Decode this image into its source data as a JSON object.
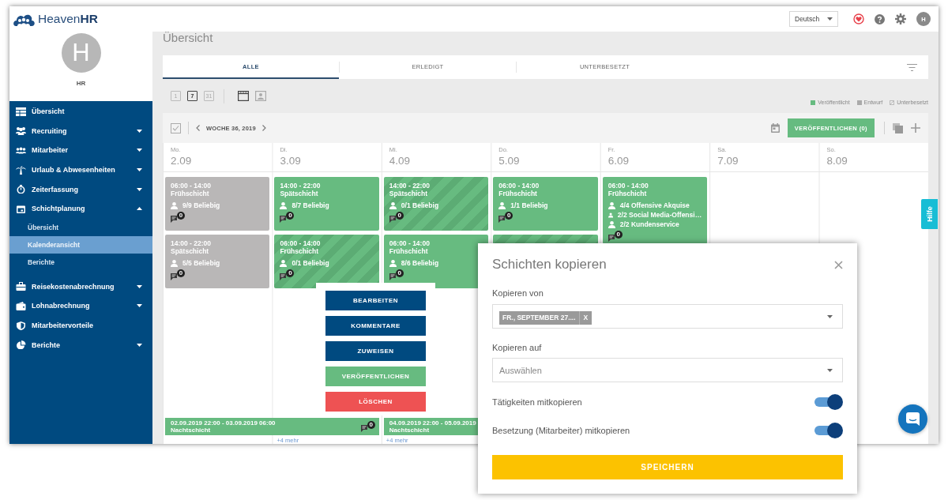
{
  "topbar": {
    "logo": "Heaven**HR**",
    "language": "Deutsch",
    "avatar": "H"
  },
  "profile": {
    "initial": "H",
    "name": "HR"
  },
  "sidebar": [
    {
      "label": "Übersicht",
      "selected": false
    },
    {
      "label": "Recruiting",
      "selected": false,
      "expanded": false
    },
    {
      "label": "Mitarbeiter",
      "selected": false,
      "expanded": false
    },
    {
      "label": "Urlaub & Abwesenheiten",
      "selected": false,
      "expanded": false
    },
    {
      "label": "Zeiterfassung",
      "selected": false,
      "expanded": false
    },
    {
      "label": "Schichtplanung",
      "selected": false,
      "expanded": true,
      "children": [
        {
          "label": "Übersicht",
          "selected": false
        },
        {
          "label": "Kalenderansicht",
          "selected": true
        },
        {
          "label": "Berichte",
          "selected": false
        }
      ]
    },
    {
      "label": "Reisekostenabrechnung",
      "selected": false,
      "expanded": false
    },
    {
      "label": "Lohnabrechnung",
      "selected": false,
      "expanded": false
    },
    {
      "label": "Mitarbeitervorteile",
      "selected": false
    },
    {
      "label": "Berichte",
      "selected": false,
      "expanded": false
    }
  ],
  "page_title": "Übersicht",
  "tabs": [
    {
      "label": "ALLE",
      "selected": true
    },
    {
      "label": "ERLEDIGT",
      "selected": false
    },
    {
      "label": "UNTERBESETZT",
      "selected": false
    }
  ],
  "range_buttons": [
    {
      "label": "1",
      "selected": false
    },
    {
      "label": "7",
      "selected": true
    },
    {
      "label": "31",
      "selected": false
    }
  ],
  "layout_buttons": [
    {
      "selected": true
    },
    {
      "selected": false
    }
  ],
  "legend": [
    {
      "label": "Veröffentlicht",
      "kind": "published"
    },
    {
      "label": "Entwurf",
      "kind": "draft"
    },
    {
      "label": "Unterbesetzt",
      "kind": "understaffed"
    }
  ],
  "week": "WOCHE 36, 2019",
  "publish_button": "VERÖFFENTLICHEN (0)",
  "days": [
    {
      "weekday": "Mo.",
      "date": "2.09",
      "shifts": [
        {
          "time": "06:00 - 14:00",
          "name": "Frühschicht",
          "kind": "draft",
          "understaffed": false,
          "assignments": [
            "9/9 Beliebig"
          ],
          "comments": "0"
        },
        {
          "time": "14:00 - 22:00",
          "name": "Spätschicht",
          "kind": "draft",
          "understaffed": false,
          "assignments": [
            "5/5 Beliebig"
          ],
          "comments": "0"
        }
      ],
      "night_shift": {
        "time": "02.09.2019 22:00 - 03.09.2019 06:00",
        "name": "Nachtschicht",
        "comments": "0"
      }
    },
    {
      "weekday": "Di.",
      "date": "3.09",
      "shifts": [
        {
          "time": "14:00 - 22:00",
          "name": "Spätschicht",
          "kind": "published",
          "understaffed": false,
          "assignments": [
            "8/7 Beliebig"
          ],
          "comments": "0"
        },
        {
          "time": "06:00 - 14:00",
          "name": "Frühschicht",
          "kind": "published",
          "understaffed": true,
          "assignments": [
            "0/1 Beliebig"
          ],
          "comments": "0"
        }
      ],
      "more": "+4 mehr"
    },
    {
      "weekday": "Mi.",
      "date": "4.09",
      "shifts": [
        {
          "time": "14:00 - 22:00",
          "name": "Spätschicht",
          "kind": "published",
          "understaffed": true,
          "assignments": [
            "0/1 Beliebig"
          ],
          "comments": "0"
        },
        {
          "time": "06:00 - 14:00",
          "name": "Frühschicht",
          "kind": "published",
          "understaffed": false,
          "assignments": [
            "8/6 Beliebig"
          ],
          "comments": "0"
        }
      ],
      "night_shift": {
        "time": "04.09.2019 22:00 - 05.09.2019",
        "name": "Nachtschicht"
      },
      "more": "+4 mehr"
    },
    {
      "weekday": "Do.",
      "date": "5.09",
      "shifts": [
        {
          "time": "06:00 - 14:00",
          "name": "Frühschicht",
          "kind": "published",
          "understaffed": false,
          "assignments": [
            "1/1 Beliebig"
          ],
          "comments": "0"
        },
        {
          "kind": "published",
          "understaffed": true
        }
      ]
    },
    {
      "weekday": "Fr.",
      "date": "6.09",
      "shifts": [
        {
          "time": "06:00 - 14:00",
          "name": "Frühschicht",
          "kind": "published",
          "understaffed": false,
          "assignments": [
            "4/4 Offensive Akquise",
            "2/2 Social Media-Offensi…",
            "2/2 Kundenservice"
          ],
          "comments": "0"
        }
      ]
    },
    {
      "weekday": "Sa.",
      "date": "7.09"
    },
    {
      "weekday": "So.",
      "date": "8.09"
    }
  ],
  "context_menu": [
    {
      "label": "BEARBEITEN",
      "kind": "primary"
    },
    {
      "label": "KOMMENTARE",
      "kind": "primary"
    },
    {
      "label": "ZUWEISEN",
      "kind": "primary"
    },
    {
      "label": "VERÖFFENTLICHEN",
      "kind": "publish"
    },
    {
      "label": "LÖSCHEN",
      "kind": "danger"
    }
  ],
  "dialog": {
    "title": "Schichten kopieren",
    "from": {
      "label": "Kopieren von",
      "chip": "FR., SEPTEMBER 27....",
      "chip_remove": "X"
    },
    "to": {
      "label": "Kopieren auf",
      "placeholder": "Auswählen"
    },
    "toggles": [
      {
        "label": "Tätigkeiten mitkopieren",
        "on": true
      },
      {
        "label": "Besetzung (Mitarbeiter) mitkopieren",
        "on": true
      }
    ],
    "save": "SPEICHERN"
  },
  "help_tab": "Hilfe"
}
